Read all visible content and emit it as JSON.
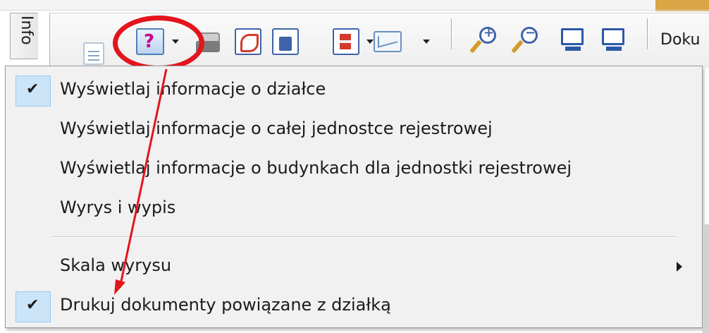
{
  "side_tab": {
    "label": "Info"
  },
  "toolbar": {
    "buttons": [
      {
        "name": "document-icon"
      },
      {
        "name": "help-info-icon",
        "glyph": "?"
      },
      {
        "name": "print-icon"
      },
      {
        "name": "pdf-export-icon"
      },
      {
        "name": "save-icon"
      },
      {
        "name": "template-icon"
      },
      {
        "name": "mail-icon"
      },
      {
        "name": "zoom-in-icon",
        "glyph": "+"
      },
      {
        "name": "zoom-out-icon",
        "glyph": "−"
      },
      {
        "name": "monitor-icon"
      },
      {
        "name": "monitor-alt-icon"
      }
    ],
    "truncated_text": "Doku"
  },
  "menu": {
    "items": [
      {
        "label": "Wyświetlaj informacje o działce",
        "checked": true
      },
      {
        "label": "Wyświetlaj informacje o całej jednostce rejestrowej",
        "checked": false
      },
      {
        "label": "Wyświetlaj informacje o budynkach dla jednostki rejestrowej",
        "checked": false
      },
      {
        "label": "Wyrys i wypis",
        "checked": false
      },
      {
        "label": "Skala wyrysu",
        "checked": false,
        "submenu": true
      },
      {
        "label": "Drukuj dokumenty powiązane z działką",
        "checked": true
      }
    ],
    "check_glyph": "✔",
    "submenu_arrow": "▶"
  },
  "annotation": {
    "highlight_color": "#e4141c",
    "arrow_color": "#e4141c"
  },
  "colors": {
    "check_background": "#cce4f7",
    "menu_background": "#f1f1f1",
    "accent": "#d9a545"
  }
}
